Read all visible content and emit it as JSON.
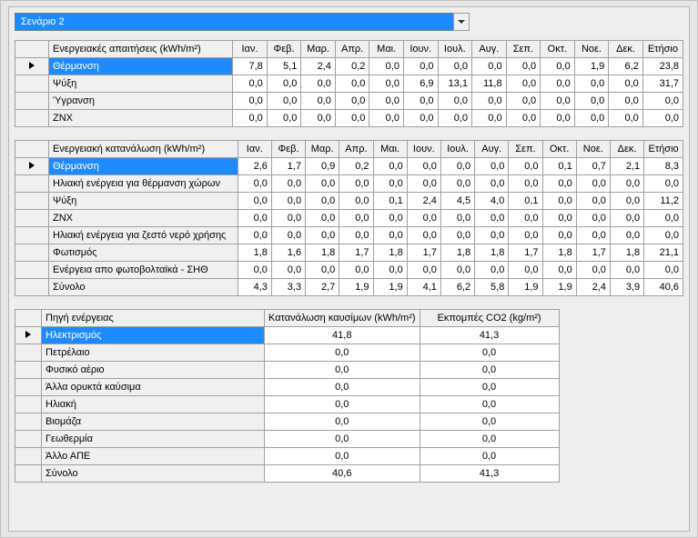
{
  "scenario": {
    "label": "Σενάριο 2"
  },
  "months": [
    "Ιαν.",
    "Φεβ.",
    "Μαρ.",
    "Απρ.",
    "Μαι.",
    "Ιουν.",
    "Ιουλ.",
    "Αυγ.",
    "Σεπ.",
    "Οκτ.",
    "Νοε.",
    "Δεκ."
  ],
  "annual_label": "Ετήσιο",
  "tables": {
    "requirements": {
      "title": "Ενεργειακές απαιτήσεις (kWh/m²)",
      "rows": [
        {
          "label": "Θέρμανση",
          "selected": true,
          "values": [
            "7,8",
            "5,1",
            "2,4",
            "0,2",
            "0,0",
            "0,0",
            "0,0",
            "0,0",
            "0,0",
            "1,9",
            "6,2",
            "23,8"
          ]
        },
        {
          "label": "Ψύξη",
          "selected": false,
          "values": [
            "0,0",
            "0,0",
            "0,0",
            "0,0",
            "0,0",
            "6,9",
            "13,1",
            "11,8",
            "0,0",
            "0,0",
            "0,0",
            "0,0",
            "31,7"
          ]
        },
        {
          "label": "Ύγρανση",
          "selected": false,
          "values": [
            "0,0",
            "0,0",
            "0,0",
            "0,0",
            "0,0",
            "0,0",
            "0,0",
            "0,0",
            "0,0",
            "0,0",
            "0,0",
            "0,0",
            "0,0"
          ]
        },
        {
          "label": "ΖΝΧ",
          "selected": false,
          "values": [
            "0,0",
            "0,0",
            "0,0",
            "0,0",
            "0,0",
            "0,0",
            "0,0",
            "0,0",
            "0,0",
            "0,0",
            "0,0",
            "0,0",
            "0,0"
          ]
        }
      ]
    },
    "consumption": {
      "title": "Ενεργειακή κατανάλωση (kWh/m²)",
      "rows": [
        {
          "label": "Θέρμανση",
          "selected": true,
          "values": [
            "2,6",
            "1,7",
            "0,9",
            "0,2",
            "0,0",
            "0,0",
            "0,0",
            "0,0",
            "0,0",
            "0,1",
            "0,7",
            "2,1",
            "8,3"
          ]
        },
        {
          "label": "Ηλιακή ενέργεια για θέρμανση χώρων",
          "selected": false,
          "values": [
            "0,0",
            "0,0",
            "0,0",
            "0,0",
            "0,0",
            "0,0",
            "0,0",
            "0,0",
            "0,0",
            "0,0",
            "0,0",
            "0,0",
            "0,0"
          ]
        },
        {
          "label": "Ψύξη",
          "selected": false,
          "values": [
            "0,0",
            "0,0",
            "0,0",
            "0,0",
            "0,1",
            "2,4",
            "4,5",
            "4,0",
            "0,1",
            "0,0",
            "0,0",
            "0,0",
            "11,2"
          ]
        },
        {
          "label": "ΖΝΧ",
          "selected": false,
          "values": [
            "0,0",
            "0,0",
            "0,0",
            "0,0",
            "0,0",
            "0,0",
            "0,0",
            "0,0",
            "0,0",
            "0,0",
            "0,0",
            "0,0",
            "0,0"
          ]
        },
        {
          "label": "Ηλιακή ενέργεια για ζεστό νερό χρήσης",
          "selected": false,
          "values": [
            "0,0",
            "0,0",
            "0,0",
            "0,0",
            "0,0",
            "0,0",
            "0,0",
            "0,0",
            "0,0",
            "0,0",
            "0,0",
            "0,0",
            "0,0"
          ]
        },
        {
          "label": "Φωτισμός",
          "selected": false,
          "values": [
            "1,8",
            "1,6",
            "1,8",
            "1,7",
            "1,8",
            "1,7",
            "1,8",
            "1,8",
            "1,7",
            "1,8",
            "1,7",
            "1,8",
            "21,1"
          ]
        },
        {
          "label": "Ενέργεια απο φωτοβολταϊκά - ΣΗΘ",
          "selected": false,
          "values": [
            "0,0",
            "0,0",
            "0,0",
            "0,0",
            "0,0",
            "0,0",
            "0,0",
            "0,0",
            "0,0",
            "0,0",
            "0,0",
            "0,0",
            "0,0"
          ]
        },
        {
          "label": "Σύνολο",
          "selected": false,
          "values": [
            "4,3",
            "3,3",
            "2,7",
            "1,9",
            "1,9",
            "4,1",
            "6,2",
            "5,8",
            "1,9",
            "1,9",
            "2,4",
            "3,9",
            "40,6"
          ]
        }
      ]
    },
    "sources": {
      "title": "Πηγή ενέργειας",
      "col1": "Κατανάλωση καυσίμων (kWh/m²)",
      "col2": "Εκπομπές CO2 (kg/m²)",
      "rows": [
        {
          "label": "Ηλεκτρισμός",
          "selected": true,
          "v1": "41,8",
          "v2": "41,3"
        },
        {
          "label": "Πετρέλαιο",
          "selected": false,
          "v1": "0,0",
          "v2": "0,0"
        },
        {
          "label": "Φυσικό αέριο",
          "selected": false,
          "v1": "0,0",
          "v2": "0,0"
        },
        {
          "label": "Άλλα ορυκτά καύσιμα",
          "selected": false,
          "v1": "0,0",
          "v2": "0,0"
        },
        {
          "label": "Ηλιακή",
          "selected": false,
          "v1": "0,0",
          "v2": "0,0"
        },
        {
          "label": "Βιομάζα",
          "selected": false,
          "v1": "0,0",
          "v2": "0,0"
        },
        {
          "label": "Γεωθερμία",
          "selected": false,
          "v1": "0,0",
          "v2": "0,0"
        },
        {
          "label": "Άλλο ΑΠΕ",
          "selected": false,
          "v1": "0,0",
          "v2": "0,0"
        },
        {
          "label": "Σύνολο",
          "selected": false,
          "v1": "40,6",
          "v2": "41,3"
        }
      ]
    }
  }
}
